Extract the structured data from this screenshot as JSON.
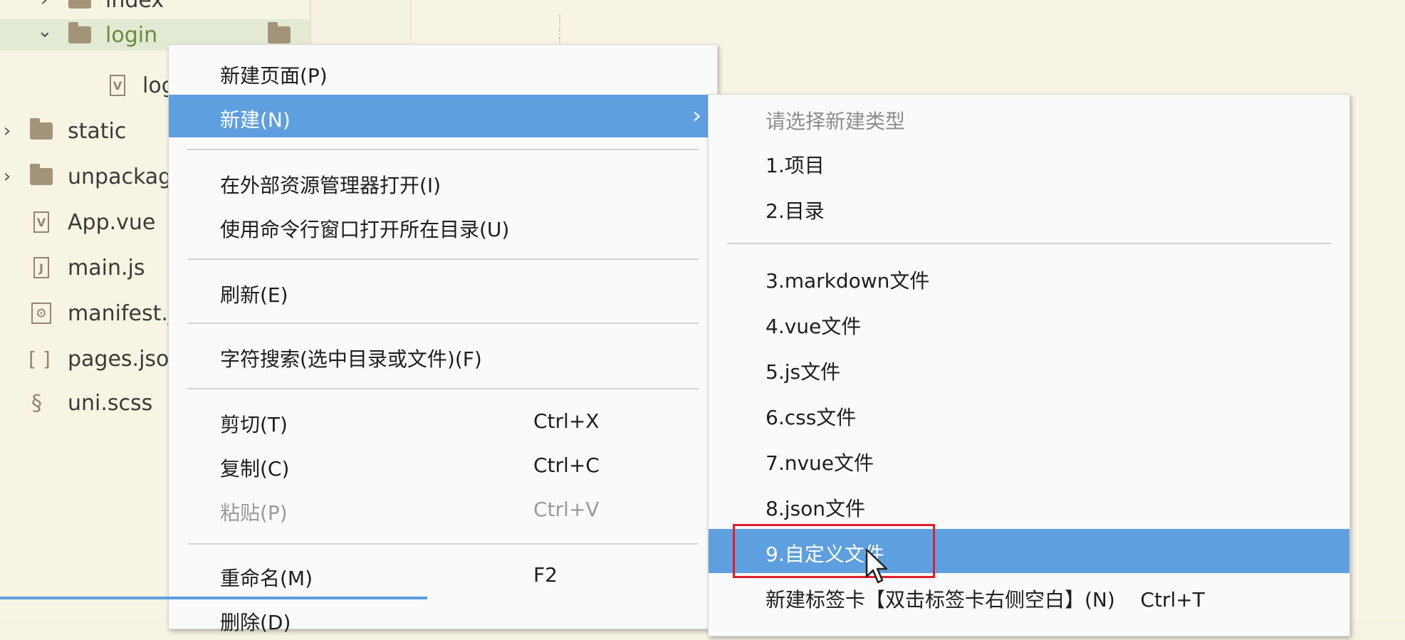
{
  "tree": [
    {
      "label": "index",
      "icon": "folder-icon",
      "chevron": "›",
      "selected": false
    },
    {
      "label": "login",
      "icon": "folder-icon",
      "chevron": "⌄",
      "selected": true
    },
    {
      "label": "logi",
      "icon": "vue-file-icon",
      "icon_text": "V",
      "chevron": "",
      "selected": false
    },
    {
      "label": "static",
      "icon": "folder-icon",
      "chevron": "›",
      "selected": false
    },
    {
      "label": "unpackag",
      "icon": "folder-icon",
      "chevron": "›",
      "selected": false
    },
    {
      "label": "App.vue",
      "icon": "vue-file-icon",
      "icon_text": "V",
      "chevron": "",
      "selected": false
    },
    {
      "label": "main.js",
      "icon": "js-file-icon",
      "icon_text": "J",
      "chevron": "",
      "selected": false
    },
    {
      "label": "manifest.j",
      "icon": "config-file-icon",
      "icon_text": "⚙",
      "chevron": "",
      "selected": false
    },
    {
      "label": "pages.jso",
      "icon": "json-file-icon",
      "icon_text": "[ ]",
      "chevron": "",
      "selected": false
    },
    {
      "label": "uni.scss",
      "icon": "scss-file-icon",
      "icon_text": "§",
      "chevron": "",
      "selected": false
    }
  ],
  "context_menu": {
    "items": [
      {
        "label": "新建页面(P)",
        "shortcut": "",
        "state": "normal",
        "arrow": ""
      },
      {
        "label": "新建(N)",
        "shortcut": "",
        "state": "highlight",
        "arrow": "›"
      },
      {
        "label": "在外部资源管理器打开(I)",
        "shortcut": "",
        "state": "normal",
        "arrow": ""
      },
      {
        "label": "使用命令行窗口打开所在目录(U)",
        "shortcut": "",
        "state": "normal",
        "arrow": ""
      },
      {
        "label": "刷新(E)",
        "shortcut": "",
        "state": "normal",
        "arrow": ""
      },
      {
        "label": "字符搜索(选中目录或文件)(F)",
        "shortcut": "",
        "state": "normal",
        "arrow": ""
      },
      {
        "label": "剪切(T)",
        "shortcut": "Ctrl+X",
        "state": "normal",
        "arrow": ""
      },
      {
        "label": "复制(C)",
        "shortcut": "Ctrl+C",
        "state": "normal",
        "arrow": ""
      },
      {
        "label": "粘贴(P)",
        "shortcut": "Ctrl+V",
        "state": "disabled",
        "arrow": ""
      },
      {
        "label": "重命名(M)",
        "shortcut": "F2",
        "state": "normal",
        "arrow": ""
      },
      {
        "label": "删除(D)",
        "shortcut": "",
        "state": "normal",
        "arrow": ""
      }
    ]
  },
  "submenu": {
    "header": "请选择新建类型",
    "items": [
      {
        "label": "1.项目",
        "state": "normal"
      },
      {
        "label": "2.目录",
        "state": "normal"
      },
      {
        "label": "3.markdown文件",
        "state": "normal"
      },
      {
        "label": "4.vue文件",
        "state": "normal"
      },
      {
        "label": "5.js文件",
        "state": "normal"
      },
      {
        "label": "6.css文件",
        "state": "normal"
      },
      {
        "label": "7.nvue文件",
        "state": "normal"
      },
      {
        "label": "8.json文件",
        "state": "normal"
      },
      {
        "label": "9.自定义文件",
        "state": "highlight"
      },
      {
        "label": "新建标签卡【双击标签卡右侧空白】(N)    Ctrl+T",
        "state": "normal"
      }
    ]
  },
  "colors": {
    "highlight": "#5e9fe0",
    "annotation": "#e21e2c"
  }
}
